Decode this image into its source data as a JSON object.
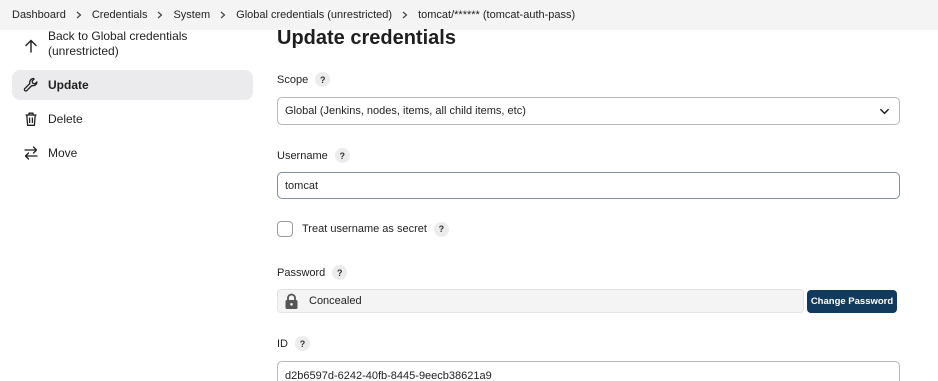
{
  "breadcrumb": {
    "items": [
      "Dashboard",
      "Credentials",
      "System",
      "Global credentials (unrestricted)",
      "tomcat/****** (tomcat-auth-pass)"
    ]
  },
  "sidebar": {
    "back_label": "Back to Global credentials (unrestricted)",
    "update_label": "Update",
    "delete_label": "Delete",
    "move_label": "Move"
  },
  "page": {
    "title": "Update credentials"
  },
  "form": {
    "scope_label": "Scope",
    "scope_value": "Global (Jenkins, nodes, items, all child items, etc)",
    "username_label": "Username",
    "username_value": "tomcat",
    "treat_secret_label": "Treat username as secret",
    "treat_secret_checked": false,
    "password_label": "Password",
    "password_value": "Concealed",
    "change_password_label": "Change Password",
    "id_label": "ID",
    "id_value": "d2b6597d-6242-40fb-8445-9eecb38621a9",
    "help_glyph": "?"
  },
  "colors": {
    "breadcrumb_bg": "#f4f4f5",
    "active_item_bg": "#ebebed",
    "primary_button": "#123a5c"
  },
  "icons": [
    "chevron-right-icon",
    "arrow-up-icon",
    "wrench-icon",
    "trash-icon",
    "arrows-swap-icon",
    "chevron-down-icon",
    "lock-icon"
  ]
}
